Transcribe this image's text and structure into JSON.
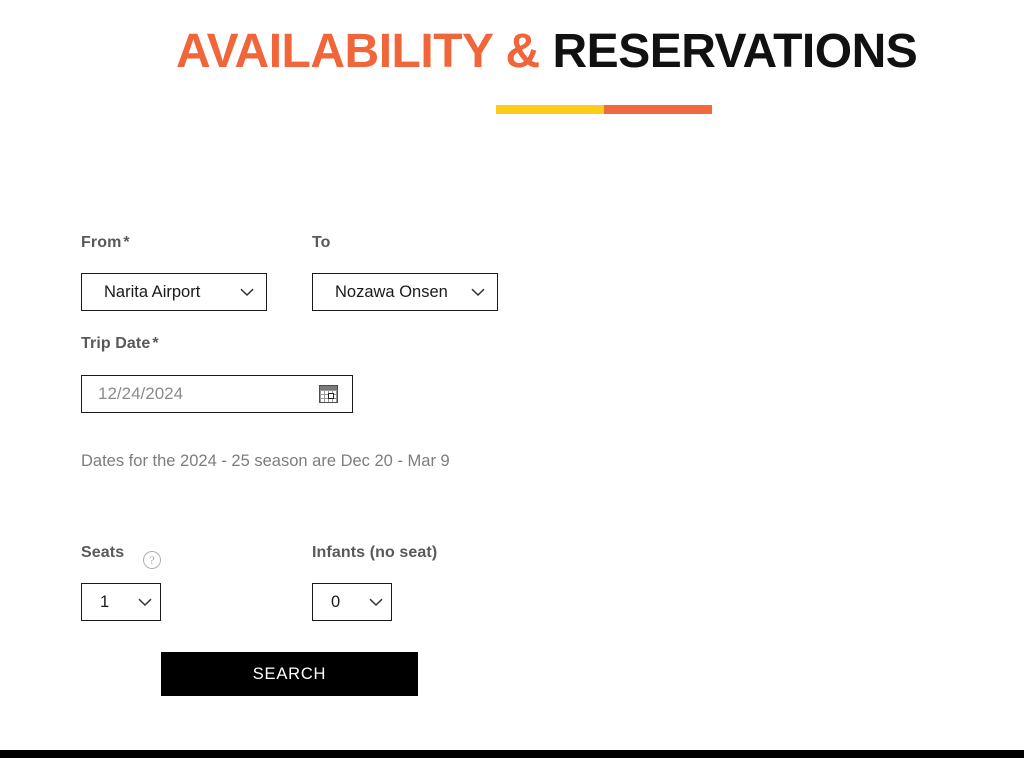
{
  "header": {
    "title_accent": "AVAILABILITY &",
    "title_main": " RESERVATIONS",
    "accent_color": "#f0653a",
    "main_color": "#111111",
    "divider": {
      "left_color": "#fbcd17",
      "right_color": "#f06a3b"
    }
  },
  "form": {
    "from": {
      "label": "From",
      "required_marker": "*",
      "value": "Narita Airport"
    },
    "to": {
      "label": "To",
      "required_marker": "",
      "value": "Nozawa Onsen"
    },
    "trip_date": {
      "label": "Trip Date",
      "required_marker": "*",
      "placeholder": "12/24/2024",
      "value": "",
      "icon": "calendar-icon"
    },
    "helper_text": "Dates for the 2024 - 25 season are Dec 20 - Mar 9",
    "seats": {
      "label": "Seats",
      "help_icon": "?",
      "help_icon_name": "question-mark-icon",
      "value": "1"
    },
    "infants": {
      "label": "Infants (no seat)",
      "value": "0"
    },
    "search_button": {
      "label": "SEARCH",
      "background": "#000000",
      "text_color": "#ffffff"
    }
  }
}
